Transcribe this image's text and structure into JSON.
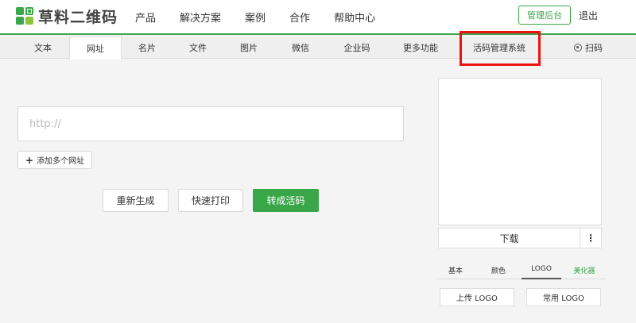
{
  "brand": {
    "name": "草料二维码"
  },
  "nav": {
    "items": [
      "产品",
      "解决方案",
      "案例",
      "合作",
      "帮助中心"
    ],
    "admin_label": "管理后台",
    "logout_label": "退出"
  },
  "tabs": {
    "items": [
      "文本",
      "网址",
      "名片",
      "文件",
      "图片",
      "微信",
      "企业码",
      "更多功能",
      "活码管理系统"
    ],
    "active": "网址",
    "scan_label": "扫码"
  },
  "form": {
    "url_placeholder": "http://",
    "url_value": "",
    "add_multi_label": "添加多个网址"
  },
  "actions": {
    "regenerate": "重新生成",
    "quick_print": "快速打印",
    "convert": "转成活码"
  },
  "preview": {
    "download_label": "下载",
    "more_label": "⋮"
  },
  "style_tabs": {
    "items": [
      "基本",
      "颜色",
      "LOGO",
      "美化器"
    ],
    "active": "LOGO",
    "highlight": "美化器"
  },
  "logo_panel": {
    "upload_label": "上传 LOGO",
    "common_label": "常用 LOGO"
  },
  "colors": {
    "accent": "#3aa64a",
    "highlight_border": "#ee1111"
  }
}
